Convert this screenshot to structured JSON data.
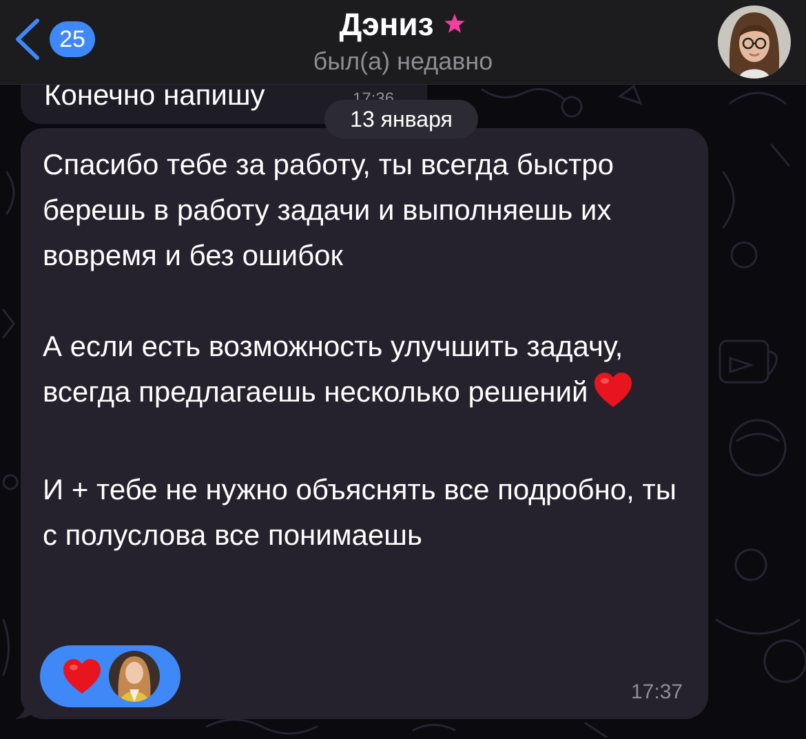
{
  "header": {
    "back_count": "25",
    "title": "Дэниз",
    "subtitle": "был(а) недавно",
    "star_icon": "star-icon",
    "accent": "#3e88f7",
    "star_color": "#f53da0"
  },
  "previous_message": {
    "text": "Конечно напишу",
    "time": "17:36"
  },
  "date_separator": "13 января",
  "message": {
    "paragraphs": [
      "Спасибо тебе за работу, ты всегда быстро берешь в работу задачи и выполняешь их вовремя и без ошибок",
      "А если есть возможность улучшить задачу, всегда предлагаешь несколько решений",
      "И + тебе не нужно объяснять все подробно, ты с полуслова все понимаешь"
    ],
    "inline_emoji": "heart-icon",
    "time": "17:37",
    "reaction": {
      "emoji": "heart-icon",
      "reacted_by": "avatar"
    }
  },
  "colors": {
    "bubble": "#25222e",
    "header_bg": "#1c1c1e",
    "background": "#0b0b0f"
  }
}
